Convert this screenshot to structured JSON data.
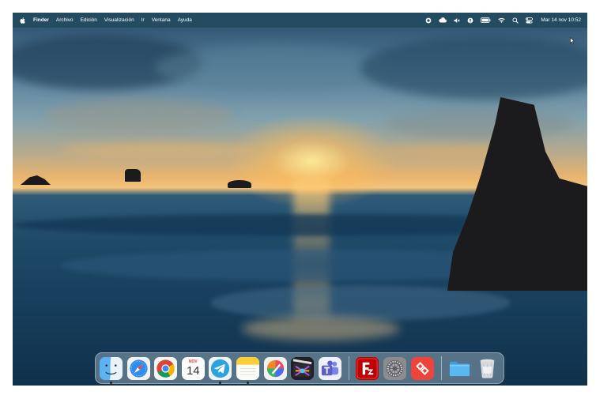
{
  "menubar": {
    "apple_icon": "apple-logo-icon",
    "items": [
      "Finder",
      "Archivo",
      "Edición",
      "Visualización",
      "Ir",
      "Ventana",
      "Ayuda"
    ],
    "status_icons": [
      "record-icon",
      "cloud-icon",
      "mute-volume-icon",
      "user-circle-icon",
      "battery-icon",
      "wifi-icon",
      "search-icon",
      "control-center-icon"
    ],
    "clock": "Mar 14 nov 10:52"
  },
  "desktop": {
    "wallpaper": "sunset-over-ocean-with-rocks"
  },
  "dock": {
    "apps": [
      {
        "name": "Finder",
        "icon": "finder-icon",
        "running": true
      },
      {
        "name": "Safari",
        "icon": "safari-icon",
        "running": false
      },
      {
        "name": "Google Chrome",
        "icon": "chrome-icon",
        "running": false
      },
      {
        "name": "Calendario",
        "icon": "calendar-icon",
        "running": false,
        "month": "NOV",
        "day": "14"
      },
      {
        "name": "Telegram",
        "icon": "telegram-icon",
        "running": true
      },
      {
        "name": "Notas",
        "icon": "notes-icon",
        "running": true
      },
      {
        "name": "Pixelmator Pro",
        "icon": "pixelmator-icon",
        "running": false
      },
      {
        "name": "Final Cut Pro",
        "icon": "final-cut-icon",
        "running": false
      },
      {
        "name": "Microsoft Teams",
        "icon": "teams-icon",
        "running": false
      },
      {
        "name": "FileZilla",
        "icon": "filezilla-icon",
        "running": false
      },
      {
        "name": "Ajustes del Sistema",
        "icon": "system-settings-icon",
        "running": false
      },
      {
        "name": "AnyDesk",
        "icon": "anydesk-icon",
        "running": false
      },
      {
        "name": "Descargas",
        "icon": "folder-icon",
        "running": false
      },
      {
        "name": "Papelera",
        "icon": "trash-icon",
        "running": false
      }
    ]
  },
  "colors": {
    "menubar_bg": "#234b5f",
    "dock_bg": "#aabecd",
    "filezilla_red": "#bf0000",
    "anydesk_red": "#ef443b",
    "telegram_blue": "#2aa3df",
    "teams_purple": "#5b5fc7"
  }
}
